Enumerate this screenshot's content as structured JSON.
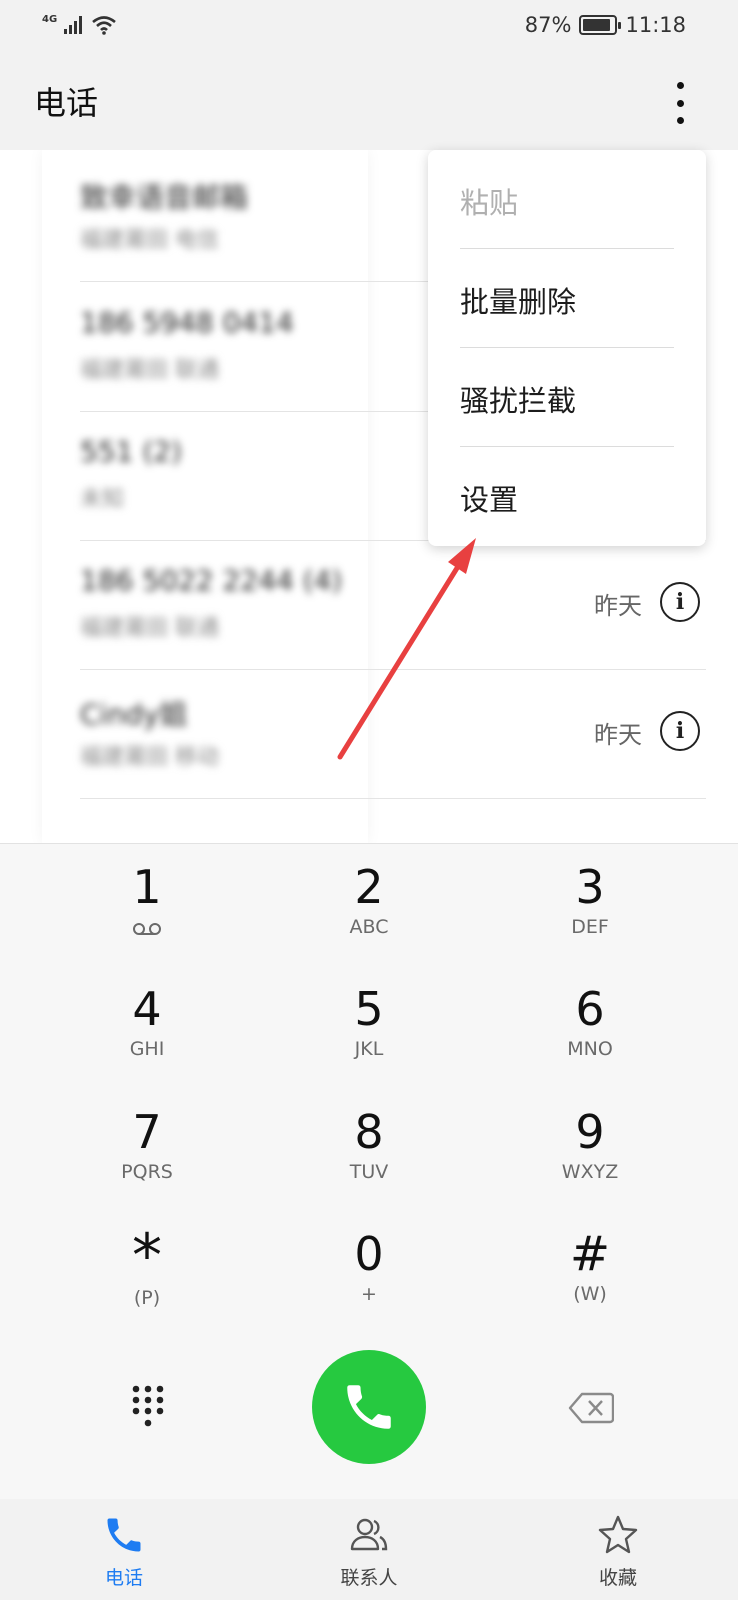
{
  "status_bar": {
    "network": "4G",
    "battery_percent_text": "87%",
    "battery_level": 0.87,
    "time": "11:18"
  },
  "app_bar": {
    "title": "电话",
    "more_icon": "more-vertical-icon"
  },
  "call_log": [
    {
      "name": "致幸语音邮箱",
      "sub": "福建莆田 电信",
      "date": ""
    },
    {
      "name": "186 5948 0414",
      "sub": "福建莆田 联通",
      "date": ""
    },
    {
      "name": "551 (2)",
      "sub": "未知",
      "date": ""
    },
    {
      "name": "186 5022 2244 (4)",
      "sub": "福建莆田 联通",
      "date": "昨天"
    },
    {
      "name": "Cindy姐",
      "sub": "福建莆田 移动",
      "date": "昨天"
    }
  ],
  "menu": {
    "items": [
      {
        "label": "粘贴",
        "enabled": false
      },
      {
        "label": "批量删除",
        "enabled": true
      },
      {
        "label": "骚扰拦截",
        "enabled": true
      },
      {
        "label": "设置",
        "enabled": true
      }
    ]
  },
  "dialpad": {
    "keys": [
      {
        "digit": "1",
        "letters": ""
      },
      {
        "digit": "2",
        "letters": "ABC"
      },
      {
        "digit": "3",
        "letters": "DEF"
      },
      {
        "digit": "4",
        "letters": "GHI"
      },
      {
        "digit": "5",
        "letters": "JKL"
      },
      {
        "digit": "6",
        "letters": "MNO"
      },
      {
        "digit": "7",
        "letters": "PQRS"
      },
      {
        "digit": "8",
        "letters": "TUV"
      },
      {
        "digit": "9",
        "letters": "WXYZ"
      },
      {
        "digit": "*",
        "letters": "(P)"
      },
      {
        "digit": "0",
        "letters": "+"
      },
      {
        "digit": "#",
        "letters": "(W)"
      }
    ],
    "call_color": "#26c940"
  },
  "bottom_nav": {
    "tabs": [
      {
        "label": "电话",
        "icon": "phone-icon",
        "active": true
      },
      {
        "label": "联系人",
        "icon": "contacts-icon",
        "active": false
      },
      {
        "label": "收藏",
        "icon": "star-icon",
        "active": false
      }
    ],
    "active_color": "#1e7cf2"
  },
  "annotation": {
    "arrow_color": "#e84040"
  }
}
